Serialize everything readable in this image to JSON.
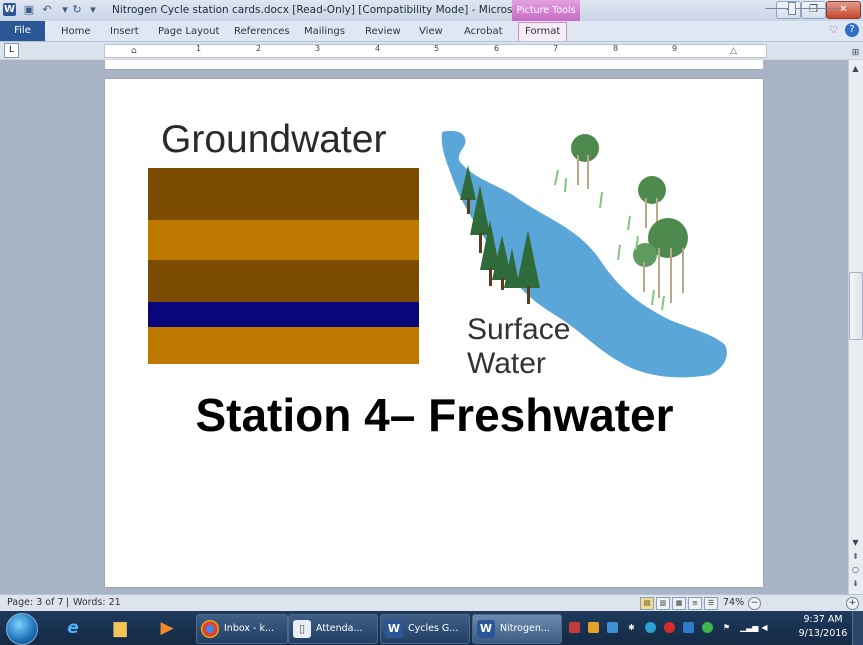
{
  "title_bar": {
    "document_title": "Nitrogen Cycle station cards.docx [Read-Only] [Compatibility Mode]  -  Microsoft Word",
    "context_tab_group": "Picture Tools"
  },
  "ribbon": {
    "tabs": [
      "File",
      "Home",
      "Insert",
      "Page Layout",
      "References",
      "Mailings",
      "Review",
      "View",
      "Acrobat",
      "Format"
    ]
  },
  "ruler": {
    "numbers": [
      "1",
      "2",
      "3",
      "4",
      "5",
      "6",
      "7",
      "8",
      "9"
    ]
  },
  "document": {
    "groundwater_title": "Groundwater",
    "surface_water_line1": "Surface",
    "surface_water_line2": "Water",
    "station_title": "Station 4– Freshwater",
    "layer_colors": [
      "#7b4b00",
      "#bf7800",
      "#7b4b00",
      "#07077a",
      "#bf7800"
    ],
    "water_color": "#5ba6d8"
  },
  "status_bar": {
    "page": "Page: 3 of 7",
    "words": "Words: 21",
    "zoom": "74%"
  },
  "taskbar": {
    "buttons": [
      {
        "label": "Inbox - k...",
        "icon": "chrome-icon"
      },
      {
        "label": "Attenda...",
        "icon": "document-icon"
      },
      {
        "label": "Cycles G...",
        "icon": "word-icon"
      },
      {
        "label": "Nitrogen...",
        "icon": "word-icon"
      }
    ],
    "time": "9:37 AM",
    "date": "9/13/2016"
  }
}
